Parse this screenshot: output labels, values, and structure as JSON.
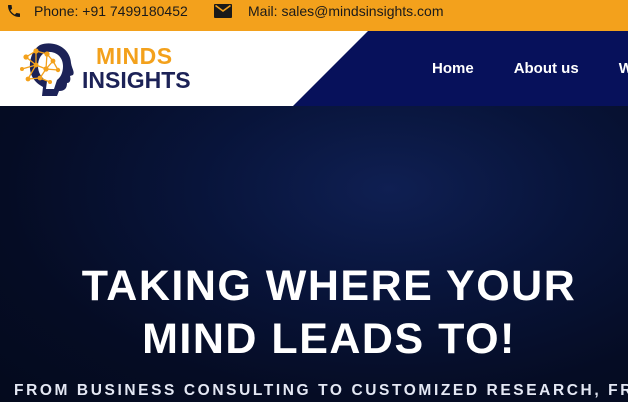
{
  "topbar": {
    "phone_icon": "phone-icon",
    "phone_text": "Phone: +91 7499180452",
    "mail_icon": "mail-icon",
    "mail_text": "Mail: sales@mindsinsights.com"
  },
  "logo": {
    "line1": "MINDS",
    "line2": "INSIGHTS",
    "icon": "brain-head-icon"
  },
  "nav": {
    "items": [
      "Home",
      "About us",
      "W"
    ]
  },
  "hero": {
    "title_line1": "TAKING WHERE YOUR",
    "title_line2": "MIND LEADS TO!",
    "subtitle": "FROM BUSINESS CONSULTING TO CUSTOMIZED RESEARCH, FRO"
  },
  "colors": {
    "topbar": "#f3a11c",
    "navbar": "#07115b",
    "logo_orange": "#f3a11c",
    "logo_navy": "#1c2257",
    "hero_bg": "#050c24"
  }
}
